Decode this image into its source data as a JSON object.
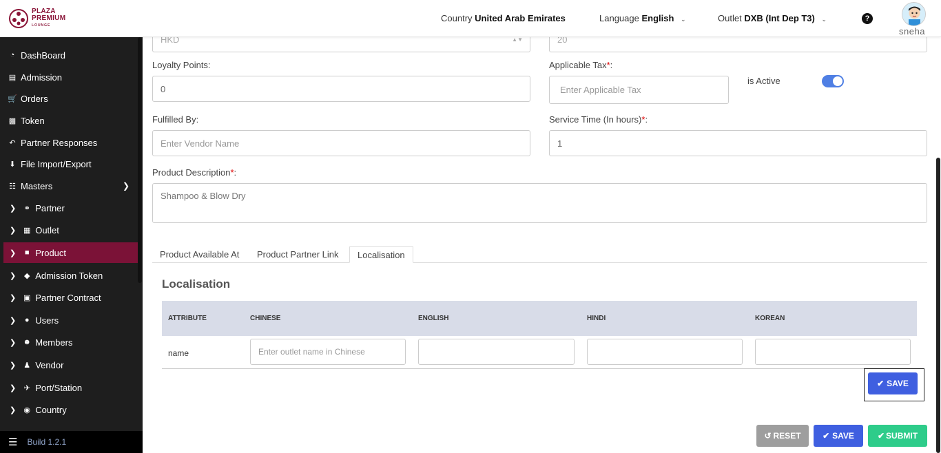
{
  "header": {
    "logo_line1": "PLAZA",
    "logo_line2": "PREMIUM",
    "logo_line3": "LOUNGE",
    "country_label": "Country",
    "country_value": "United Arab Emirates",
    "language_label": "Language",
    "language_value": "English",
    "outlet_label": "Outlet",
    "outlet_value": "DXB (Int Dep T3)",
    "user_name": "sneha"
  },
  "sidebar": {
    "top_items": [
      {
        "label": "DashBoard",
        "icon": "dashboard-icon"
      },
      {
        "label": "Admission",
        "icon": "id-card-icon"
      },
      {
        "label": "Orders",
        "icon": "cart-icon"
      },
      {
        "label": "Token",
        "icon": "file-icon"
      },
      {
        "label": "Partner Responses",
        "icon": "reply-icon"
      },
      {
        "label": "File Import/Export",
        "icon": "download-icon"
      },
      {
        "label": "Masters",
        "icon": "sitemap-icon"
      }
    ],
    "sub_items": [
      {
        "label": "Partner",
        "icon": "handshake-icon"
      },
      {
        "label": "Outlet",
        "icon": "building-icon"
      },
      {
        "label": "Product",
        "icon": "gift-icon",
        "active": true
      },
      {
        "label": "Admission Token",
        "icon": "ticket-icon"
      },
      {
        "label": "Partner Contract",
        "icon": "briefcase-icon"
      },
      {
        "label": "Users",
        "icon": "user-icon"
      },
      {
        "label": "Members",
        "icon": "users-icon"
      },
      {
        "label": "Vendor",
        "icon": "person-icon"
      },
      {
        "label": "Port/Station",
        "icon": "plane-icon"
      },
      {
        "label": "Country",
        "icon": "globe-icon"
      }
    ],
    "build": "Build 1.2.1",
    "active_color": "#7b1237"
  },
  "form": {
    "currency_value": "HKD",
    "price_value": "20",
    "loyalty_label": "Loyalty Points:",
    "loyalty_value": "0",
    "tax_label": "Applicable Tax",
    "tax_placeholder": "Enter Applicable Tax",
    "active_label": "is Active",
    "active_on": true,
    "fulfilled_label": "Fulfilled By:",
    "fulfilled_placeholder": "Enter Vendor Name",
    "service_label": "Service Time (In hours)",
    "service_value": "1",
    "description_label": "Product Description",
    "description_value": "Shampoo & Blow Dry"
  },
  "tabs": [
    "Product Available At",
    "Product Partner Link",
    "Localisation"
  ],
  "localisation": {
    "title": "Localisation",
    "columns": [
      "ATTRIBUTE",
      "CHINESE",
      "ENGLISH",
      "HINDI",
      "KOREAN"
    ],
    "row_attribute": "name",
    "chinese_placeholder": "Enter outlet name in Chinese",
    "save_label": "SAVE"
  },
  "actions": {
    "reset_label": "RESET",
    "save_label": "SAVE",
    "submit_label": "SUBMIT"
  },
  "colors": {
    "primary": "#3f5fe0",
    "reset": "#9e9e9e",
    "submit": "#2ecc8a"
  }
}
